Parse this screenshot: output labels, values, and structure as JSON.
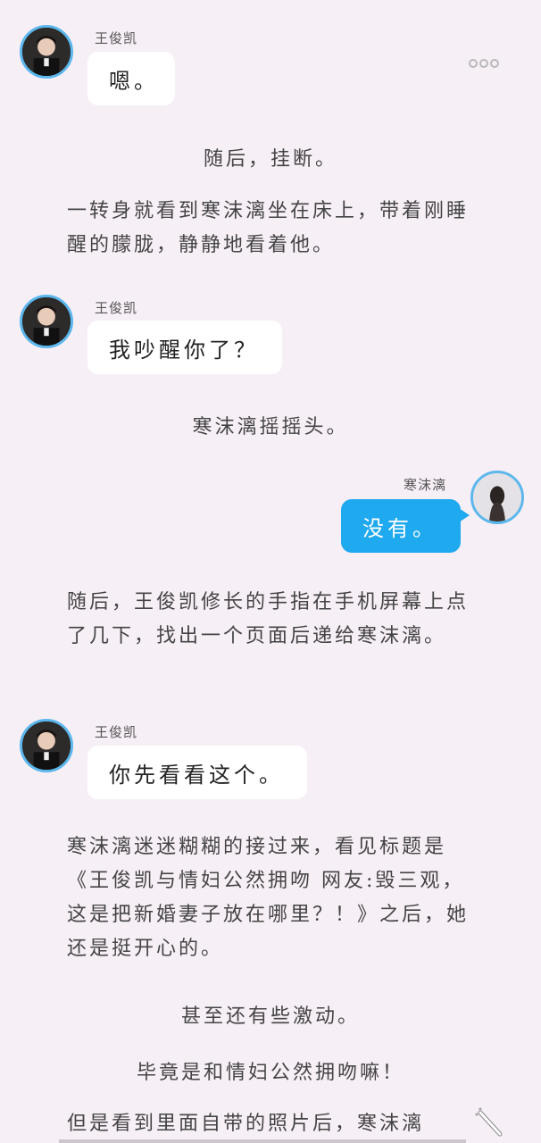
{
  "icons": {
    "more": "more-options-icon",
    "magic": "magic-wand-icon"
  },
  "characters": {
    "wjk": "王俊凯",
    "hml": "寒沫漓"
  },
  "messages": [
    {
      "speaker": "王俊凯",
      "text": "嗯。"
    },
    {
      "speaker": "王俊凯",
      "text": "我吵醒你了？"
    },
    {
      "speaker": "寒沫漓",
      "text": "没有。"
    },
    {
      "speaker": "王俊凯",
      "text": "你先看看这个。"
    }
  ],
  "narration": {
    "n1": "随后，挂断。",
    "n2": "一转身就看到寒沫漓坐在床上，带着刚睡醒的朦胧，静静地看着他。",
    "n3": "寒沫漓摇摇头。",
    "n4": "随后，王俊凯修长的手指在手机屏幕上点了几下，找出一个页面后递给寒沫漓。",
    "n5": "寒沫漓迷迷糊糊的接过来，看见标题是《王俊凯与情妇公然拥吻 网友:毁三观，这是把新婚妻子放在哪里？！》之后，她还是挺开心的。",
    "n6": "甚至还有些激动。",
    "n7": "毕竟是和情妇公然拥吻嘛！",
    "n8": "但是看到里面自带的照片后，寒沫漓"
  }
}
